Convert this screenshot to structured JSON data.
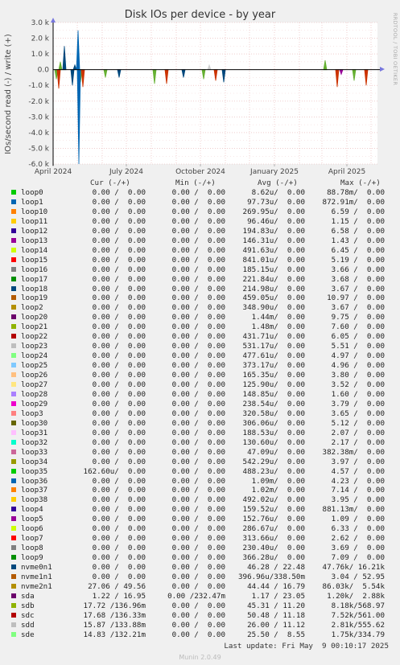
{
  "page": {
    "title": "Disk IOs per device - by year",
    "ylabel": "IOs/second read (-) / write (+)",
    "side_text": "RRDTOOL / TOBI OETIKER",
    "last_update": "Last update: Fri May  9 00:10:17 2025",
    "munin_version": "Munin 2.0.49",
    "col_cur": "Cur (-/+)",
    "col_min": "Min (-/+)",
    "col_avg": "Avg (-/+)",
    "col_max": "Max (-/+)"
  },
  "chart_data": {
    "type": "area",
    "title": "Disk IOs per device - by year",
    "ylabel": "IOs/second read (-) / write (+)",
    "ylim": [
      -6000,
      3000
    ],
    "yticks": [
      3000,
      2000,
      1000,
      0,
      -1000,
      -2000,
      -3000,
      -4000,
      -5000,
      -6000
    ],
    "ytick_labels": [
      "3.0 k",
      "2.0 k",
      "1.0 k",
      "0.0",
      "-1.0 k",
      "-2.0 k",
      "-3.0 k",
      "-4.0 k",
      "-5.0 k",
      "-6.0 k"
    ],
    "xlim": [
      "2024-04-01",
      "2025-05-09"
    ],
    "xticks": [
      "2024-04-01",
      "2024-07-01",
      "2024-10-01",
      "2025-01-01",
      "2025-04-01"
    ],
    "xtick_labels": [
      "April 2024",
      "July 2024",
      "October 2024",
      "January 2025",
      "April 2025"
    ],
    "grid": true,
    "series": [
      {
        "name": "sdb",
        "color": "#66B032",
        "x": [
          "2024-04-05",
          "2024-04-10",
          "2024-05-05",
          "2024-06-05",
          "2024-08-05",
          "2024-10-05",
          "2025-03-05",
          "2025-04-10"
        ],
        "values": [
          -600,
          500,
          -800,
          -500,
          -900,
          -600,
          600,
          -700
        ]
      },
      {
        "name": "sdc",
        "color": "#CC3300",
        "x": [
          "2024-04-08",
          "2024-05-08",
          "2024-08-20",
          "2024-10-20",
          "2025-03-20",
          "2025-04-25"
        ],
        "values": [
          -1200,
          -1100,
          -900,
          -700,
          -1100,
          -1000
        ]
      },
      {
        "name": "nvme0n1",
        "color": "#00487D",
        "x": [
          "2024-04-15",
          "2024-04-25",
          "2024-04-28",
          "2024-06-22",
          "2024-09-10",
          "2024-10-30"
        ],
        "values": [
          1500,
          -1000,
          300,
          -500,
          -500,
          -800
        ]
      },
      {
        "name": "loop1",
        "color": "#0066B3",
        "x": [
          "2024-05-02",
          "2024-05-03"
        ],
        "values": [
          2500,
          -6000
        ]
      },
      {
        "name": "sdd",
        "color": "#CFCFCF",
        "x": [
          "2024-10-12"
        ],
        "values": [
          300
        ]
      },
      {
        "name": "sda",
        "color": "#990099",
        "x": [
          "2025-03-25"
        ],
        "values": [
          -300
        ]
      }
    ]
  },
  "legend": [
    {
      "name": "loop0",
      "color": "#00CC00",
      "cur": "0.00 /  0.00",
      "min": "0.00 /  0.00",
      "avg": "8.62u/  0.00",
      "max": "88.78m/  0.00"
    },
    {
      "name": "loop1",
      "color": "#0066B3",
      "cur": "0.00 /  0.00",
      "min": "0.00 /  0.00",
      "avg": "97.73u/  0.00",
      "max": "872.91m/  0.00"
    },
    {
      "name": "loop10",
      "color": "#FF8000",
      "cur": "0.00 /  0.00",
      "min": "0.00 /  0.00",
      "avg": "269.95u/  0.00",
      "max": "6.59 /  0.00"
    },
    {
      "name": "loop11",
      "color": "#FFCC00",
      "cur": "0.00 /  0.00",
      "min": "0.00 /  0.00",
      "avg": "96.46u/  0.00",
      "max": "1.15 /  0.00"
    },
    {
      "name": "loop12",
      "color": "#330099",
      "cur": "0.00 /  0.00",
      "min": "0.00 /  0.00",
      "avg": "194.83u/  0.00",
      "max": "6.58 /  0.00"
    },
    {
      "name": "loop13",
      "color": "#990099",
      "cur": "0.00 /  0.00",
      "min": "0.00 /  0.00",
      "avg": "146.31u/  0.00",
      "max": "1.43 /  0.00"
    },
    {
      "name": "loop14",
      "color": "#CCFF00",
      "cur": "0.00 /  0.00",
      "min": "0.00 /  0.00",
      "avg": "491.63u/  0.00",
      "max": "6.45 /  0.00"
    },
    {
      "name": "loop15",
      "color": "#FF0000",
      "cur": "0.00 /  0.00",
      "min": "0.00 /  0.00",
      "avg": "841.01u/  0.00",
      "max": "5.19 /  0.00"
    },
    {
      "name": "loop16",
      "color": "#808080",
      "cur": "0.00 /  0.00",
      "min": "0.00 /  0.00",
      "avg": "185.15u/  0.00",
      "max": "3.66 /  0.00"
    },
    {
      "name": "loop17",
      "color": "#008F00",
      "cur": "0.00 /  0.00",
      "min": "0.00 /  0.00",
      "avg": "221.84u/  0.00",
      "max": "3.68 /  0.00"
    },
    {
      "name": "loop18",
      "color": "#00487D",
      "cur": "0.00 /  0.00",
      "min": "0.00 /  0.00",
      "avg": "214.98u/  0.00",
      "max": "3.67 /  0.00"
    },
    {
      "name": "loop19",
      "color": "#B35A00",
      "cur": "0.00 /  0.00",
      "min": "0.00 /  0.00",
      "avg": "459.05u/  0.00",
      "max": "10.97 /  0.00"
    },
    {
      "name": "loop2",
      "color": "#B38F00",
      "cur": "0.00 /  0.00",
      "min": "0.00 /  0.00",
      "avg": "348.90u/  0.00",
      "max": "3.67 /  0.00"
    },
    {
      "name": "loop20",
      "color": "#6B006B",
      "cur": "0.00 /  0.00",
      "min": "0.00 /  0.00",
      "avg": "1.44m/  0.00",
      "max": "9.75 /  0.00"
    },
    {
      "name": "loop21",
      "color": "#8FB300",
      "cur": "0.00 /  0.00",
      "min": "0.00 /  0.00",
      "avg": "1.48m/  0.00",
      "max": "7.60 /  0.00"
    },
    {
      "name": "loop22",
      "color": "#B30000",
      "cur": "0.00 /  0.00",
      "min": "0.00 /  0.00",
      "avg": "431.71u/  0.00",
      "max": "6.05 /  0.00"
    },
    {
      "name": "loop23",
      "color": "#BEBEBE",
      "cur": "0.00 /  0.00",
      "min": "0.00 /  0.00",
      "avg": "531.17u/  0.00",
      "max": "5.51 /  0.00"
    },
    {
      "name": "loop24",
      "color": "#80FF80",
      "cur": "0.00 /  0.00",
      "min": "0.00 /  0.00",
      "avg": "477.61u/  0.00",
      "max": "4.97 /  0.00"
    },
    {
      "name": "loop25",
      "color": "#80C9FF",
      "cur": "0.00 /  0.00",
      "min": "0.00 /  0.00",
      "avg": "373.17u/  0.00",
      "max": "4.96 /  0.00"
    },
    {
      "name": "loop26",
      "color": "#FFC080",
      "cur": "0.00 /  0.00",
      "min": "0.00 /  0.00",
      "avg": "165.35u/  0.00",
      "max": "3.80 /  0.00"
    },
    {
      "name": "loop27",
      "color": "#FFE680",
      "cur": "0.00 /  0.00",
      "min": "0.00 /  0.00",
      "avg": "125.90u/  0.00",
      "max": "3.52 /  0.00"
    },
    {
      "name": "loop28",
      "color": "#AA80FF",
      "cur": "0.00 /  0.00",
      "min": "0.00 /  0.00",
      "avg": "148.85u/  0.00",
      "max": "1.60 /  0.00"
    },
    {
      "name": "loop29",
      "color": "#EE00CC",
      "cur": "0.00 /  0.00",
      "min": "0.00 /  0.00",
      "avg": "238.54u/  0.00",
      "max": "3.79 /  0.00"
    },
    {
      "name": "loop3",
      "color": "#FF8080",
      "cur": "0.00 /  0.00",
      "min": "0.00 /  0.00",
      "avg": "320.58u/  0.00",
      "max": "3.65 /  0.00"
    },
    {
      "name": "loop30",
      "color": "#666600",
      "cur": "0.00 /  0.00",
      "min": "0.00 /  0.00",
      "avg": "306.06u/  0.00",
      "max": "5.12 /  0.00"
    },
    {
      "name": "loop31",
      "color": "#FFBFFF",
      "cur": "0.00 /  0.00",
      "min": "0.00 /  0.00",
      "avg": "188.53u/  0.00",
      "max": "2.07 /  0.00"
    },
    {
      "name": "loop32",
      "color": "#00FFCC",
      "cur": "0.00 /  0.00",
      "min": "0.00 /  0.00",
      "avg": "130.60u/  0.00",
      "max": "2.17 /  0.00"
    },
    {
      "name": "loop33",
      "color": "#CC6699",
      "cur": "0.00 /  0.00",
      "min": "0.00 /  0.00",
      "avg": "47.09u/  0.00",
      "max": "382.38m/  0.00"
    },
    {
      "name": "loop34",
      "color": "#999900",
      "cur": "0.00 /  0.00",
      "min": "0.00 /  0.00",
      "avg": "542.29u/  0.00",
      "max": "3.97 /  0.00"
    },
    {
      "name": "loop35",
      "color": "#00CC00",
      "cur": "162.60u/  0.00",
      "min": "0.00 /  0.00",
      "avg": "488.23u/  0.00",
      "max": "4.57 /  0.00"
    },
    {
      "name": "loop36",
      "color": "#0066B3",
      "cur": "0.00 /  0.00",
      "min": "0.00 /  0.00",
      "avg": "1.09m/  0.00",
      "max": "4.23 /  0.00"
    },
    {
      "name": "loop37",
      "color": "#FF8000",
      "cur": "0.00 /  0.00",
      "min": "0.00 /  0.00",
      "avg": "1.02m/  0.00",
      "max": "7.14 /  0.00"
    },
    {
      "name": "loop38",
      "color": "#FFCC00",
      "cur": "0.00 /  0.00",
      "min": "0.00 /  0.00",
      "avg": "492.02u/  0.00",
      "max": "3.95 /  0.00"
    },
    {
      "name": "loop4",
      "color": "#330099",
      "cur": "0.00 /  0.00",
      "min": "0.00 /  0.00",
      "avg": "159.52u/  0.00",
      "max": "881.13m/  0.00"
    },
    {
      "name": "loop5",
      "color": "#990099",
      "cur": "0.00 /  0.00",
      "min": "0.00 /  0.00",
      "avg": "152.76u/  0.00",
      "max": "1.09 /  0.00"
    },
    {
      "name": "loop6",
      "color": "#CCFF00",
      "cur": "0.00 /  0.00",
      "min": "0.00 /  0.00",
      "avg": "286.67u/  0.00",
      "max": "6.33 /  0.00"
    },
    {
      "name": "loop7",
      "color": "#FF0000",
      "cur": "0.00 /  0.00",
      "min": "0.00 /  0.00",
      "avg": "313.66u/  0.00",
      "max": "2.62 /  0.00"
    },
    {
      "name": "loop8",
      "color": "#808080",
      "cur": "0.00 /  0.00",
      "min": "0.00 /  0.00",
      "avg": "230.40u/  0.00",
      "max": "3.69 /  0.00"
    },
    {
      "name": "loop9",
      "color": "#008F00",
      "cur": "0.00 /  0.00",
      "min": "0.00 /  0.00",
      "avg": "366.28u/  0.00",
      "max": "7.09 /  0.00"
    },
    {
      "name": "nvme0n1",
      "color": "#00487D",
      "cur": "0.00 /  0.00",
      "min": "0.00 /  0.00",
      "avg": "46.28 / 22.48",
      "max": "47.76k/ 16.21k"
    },
    {
      "name": "nvme1n1",
      "color": "#B35A00",
      "cur": "0.00 /  0.00",
      "min": "0.00 /  0.00",
      "avg": "396.96u/338.50m",
      "max": "3.04 / 52.95"
    },
    {
      "name": "nvme2n1",
      "color": "#B38F00",
      "cur": "27.06 / 49.56",
      "min": "0.00 /  0.00",
      "avg": "44.44 / 16.79",
      "max": "86.03k/  5.54k"
    },
    {
      "name": "sda",
      "color": "#6B006B",
      "cur": "1.22 / 16.95",
      "min": "0.00 /232.47m",
      "avg": "1.17 / 23.05",
      "max": "1.20k/  2.88k"
    },
    {
      "name": "sdb",
      "color": "#8FB300",
      "cur": "17.72 /136.96m",
      "min": "0.00 /  0.00",
      "avg": "45.31 / 11.20",
      "max": "8.18k/568.97"
    },
    {
      "name": "sdc",
      "color": "#B30000",
      "cur": "17.68 /136.33m",
      "min": "0.00 /  0.00",
      "avg": "50.48 / 11.18",
      "max": "7.52k/561.00"
    },
    {
      "name": "sdd",
      "color": "#BEBEBE",
      "cur": "15.87 /133.88m",
      "min": "0.00 /  0.00",
      "avg": "26.00 / 11.12",
      "max": "2.81k/555.62"
    },
    {
      "name": "sde",
      "color": "#80FF80",
      "cur": "14.83 /132.21m",
      "min": "0.00 /  0.00",
      "avg": "25.50 /  8.55",
      "max": "1.75k/334.79"
    }
  ]
}
